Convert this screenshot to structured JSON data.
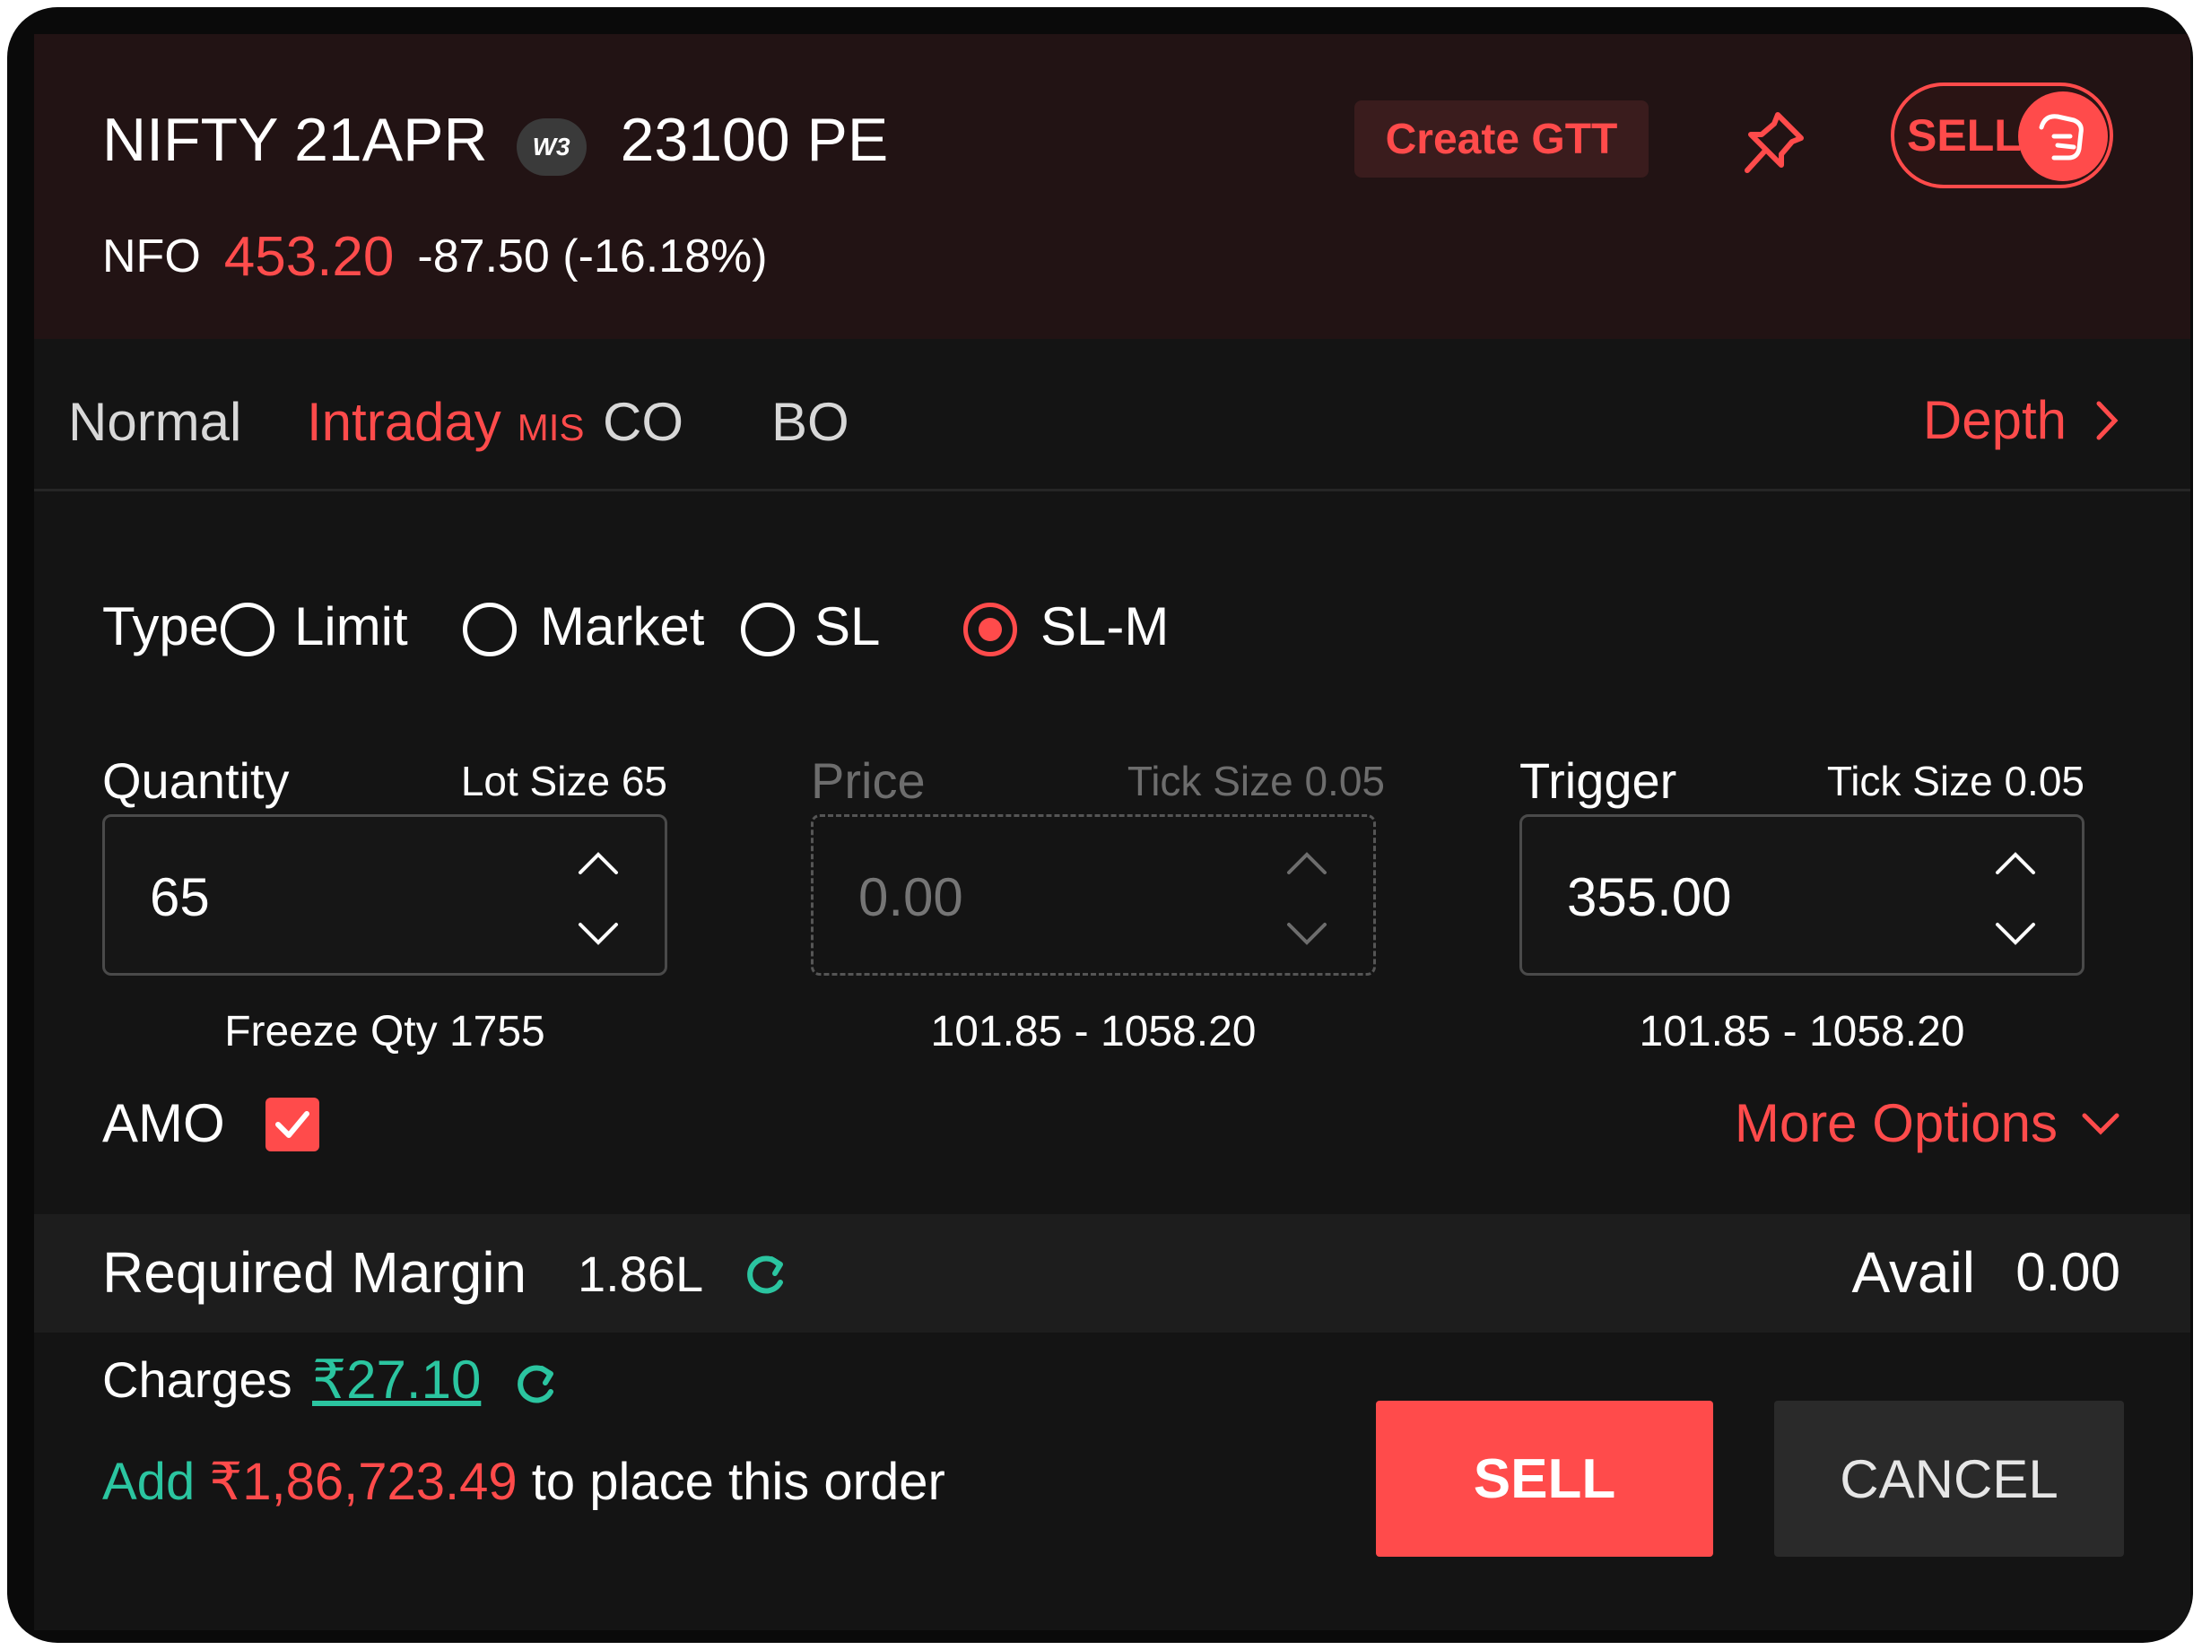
{
  "header": {
    "symbol": "NIFTY 21APR",
    "weekly_badge": "W3",
    "strike": "23100 PE",
    "exchange": "NFO",
    "ltp": "453.20",
    "change": "-87.50 (-16.18%)",
    "gtt_label": "Create GTT",
    "toggle_label": "SELL",
    "pin_icon": "pin-icon",
    "toggle_icon": "hand-icon"
  },
  "tabs": [
    {
      "label": "Normal",
      "sub": ""
    },
    {
      "label": "Intraday",
      "sub": "MIS"
    },
    {
      "label": "CO",
      "sub": ""
    },
    {
      "label": "BO",
      "sub": ""
    }
  ],
  "active_tab": "Intraday",
  "depth_label": "Depth",
  "order_type": {
    "label": "Type",
    "options": [
      "Limit",
      "Market",
      "SL",
      "SL-M"
    ],
    "selected": "SL-M"
  },
  "quantity": {
    "label": "Quantity",
    "meta": "Lot Size 65",
    "value": "65",
    "note": "Freeze Qty 1755"
  },
  "price": {
    "label": "Price",
    "meta": "Tick Size 0.05",
    "placeholder": "0.00",
    "range": "101.85 - 1058.20",
    "disabled": true
  },
  "trigger": {
    "label": "Trigger",
    "meta": "Tick Size 0.05",
    "value": "355.00",
    "range": "101.85 - 1058.20"
  },
  "amo": {
    "label": "AMO",
    "checked": true
  },
  "more_options_label": "More Options",
  "margin": {
    "label": "Required Margin",
    "value": "1.86L",
    "avail_label": "Avail",
    "avail_value": "0.00"
  },
  "charges": {
    "label": "Charges",
    "value": "₹27.10"
  },
  "shortfall": {
    "prefix": "Add",
    "amount": "₹1,86,723.49",
    "suffix": "to place this order"
  },
  "actions": {
    "sell_label": "SELL",
    "cancel_label": "CANCEL"
  },
  "colors": {
    "accent": "#ff4b4b",
    "positive": "#2bc5a0",
    "background": "#141414",
    "header_bg": "#221314"
  }
}
